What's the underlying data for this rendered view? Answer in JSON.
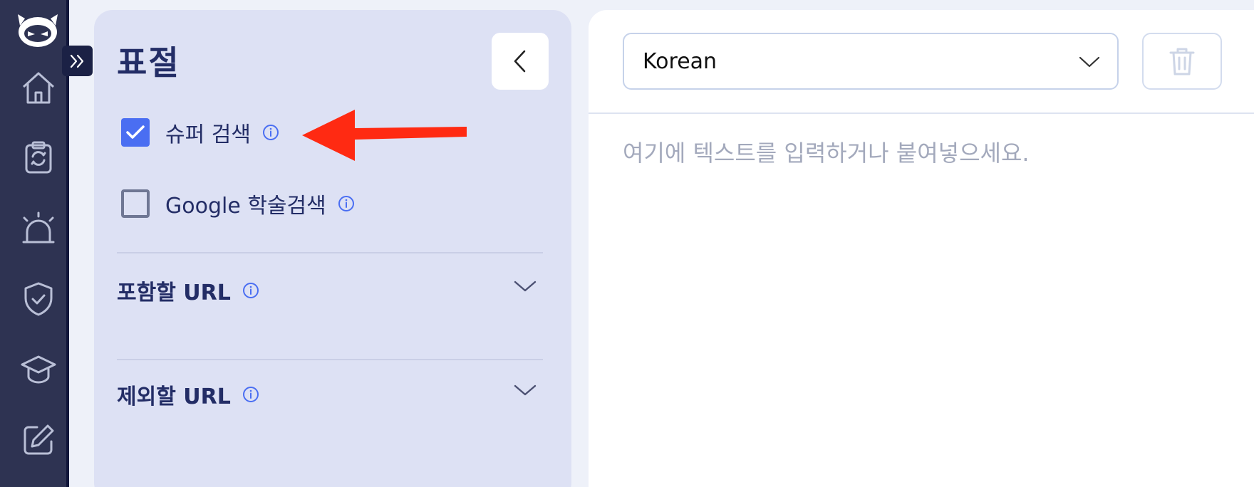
{
  "sidebar": {
    "icons": [
      "robot-logo",
      "home-icon",
      "clipboard-refresh-icon",
      "alarm-icon",
      "shield-check-icon",
      "graduation-cap-icon",
      "edit-icon"
    ],
    "expand_icon": "chevron-double-right-icon"
  },
  "panel": {
    "title": "표절",
    "back_icon": "chevron-left-icon",
    "options": [
      {
        "label": "슈퍼 검색",
        "checked": true
      },
      {
        "label": "Google 학술검색",
        "checked": false
      }
    ],
    "sections": [
      {
        "label": "포함할 URL"
      },
      {
        "label": "제외할 URL"
      }
    ]
  },
  "editor": {
    "language": "Korean",
    "placeholder": "여기에 텍스트를 입력하거나 붙여넣으세요.",
    "trash_icon": "trash-icon"
  },
  "colors": {
    "rail": "#2e3352",
    "panel": "#dde1f4",
    "accent": "#4a6ef2",
    "heading": "#232d66",
    "annotation": "#ff2a12"
  }
}
